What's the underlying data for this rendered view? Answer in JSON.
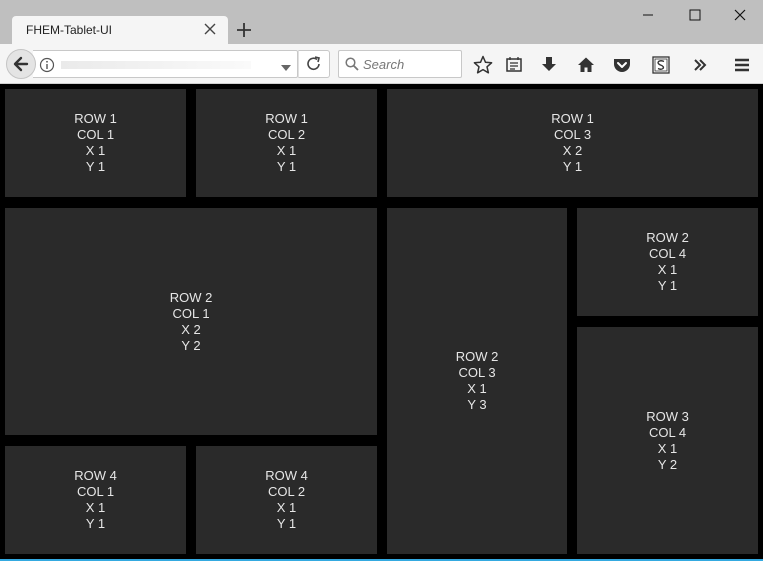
{
  "browser": {
    "tab_title": "FHEM-Tablet-UI",
    "search_placeholder": "Search",
    "icons": {
      "back": "back-arrow-icon",
      "info": "info-icon",
      "reload": "reload-icon",
      "search": "search-icon",
      "bookmark": "star-icon",
      "reader": "reading-list-icon",
      "download": "download-icon",
      "home": "home-icon",
      "pocket": "pocket-icon",
      "extension": "extension-s-icon",
      "overflow": "chevron-double-right-icon",
      "menu": "hamburger-menu-icon"
    }
  },
  "tiles": [
    {
      "row": "ROW 1",
      "col": "COL 1",
      "x": "X 1",
      "y": "Y 1"
    },
    {
      "row": "ROW 1",
      "col": "COL 2",
      "x": "X 1",
      "y": "Y 1"
    },
    {
      "row": "ROW 1",
      "col": "COL 3",
      "x": "X 2",
      "y": "Y 1"
    },
    {
      "row": "ROW 2",
      "col": "COL 1",
      "x": "X 2",
      "y": "Y 2"
    },
    {
      "row": "ROW 2",
      "col": "COL 3",
      "x": "X 1",
      "y": "Y 3"
    },
    {
      "row": "ROW 2",
      "col": "COL 4",
      "x": "X 1",
      "y": "Y 1"
    },
    {
      "row": "ROW 3",
      "col": "COL 4",
      "x": "X 1",
      "y": "Y 2"
    },
    {
      "row": "ROW 4",
      "col": "COL 1",
      "x": "X 1",
      "y": "Y 1"
    },
    {
      "row": "ROW 4",
      "col": "COL 2",
      "x": "X 1",
      "y": "Y 1"
    }
  ],
  "colors": {
    "tile_bg": "#2a2a2a",
    "page_bg": "#000000",
    "tile_text": "#e6e6e6"
  }
}
